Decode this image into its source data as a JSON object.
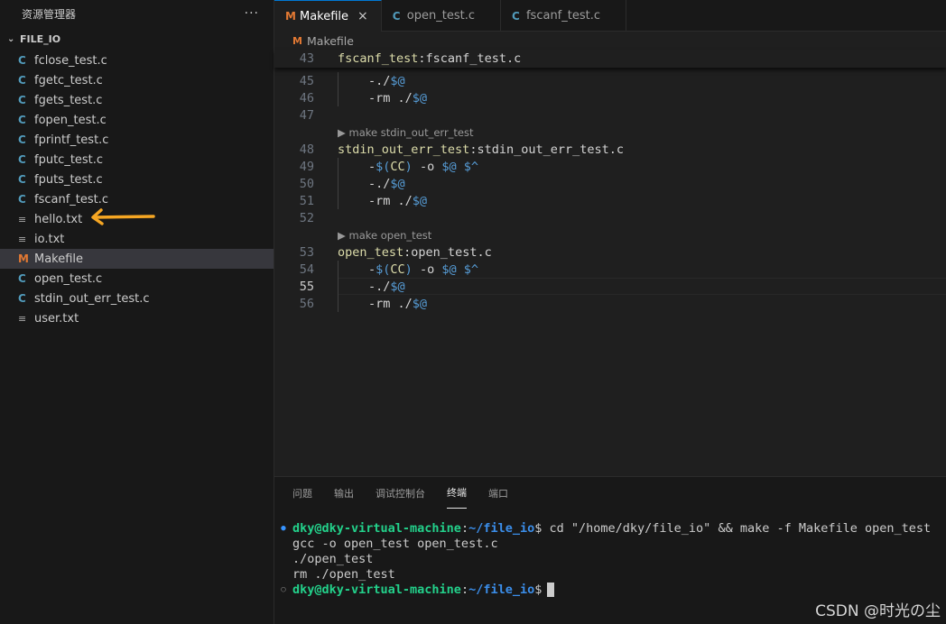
{
  "sidebar": {
    "title": "资源管理器",
    "more": "···",
    "folder": "FILE_IO",
    "files": [
      {
        "name": "fclose_test.c",
        "icon": "C"
      },
      {
        "name": "fgetc_test.c",
        "icon": "C"
      },
      {
        "name": "fgets_test.c",
        "icon": "C"
      },
      {
        "name": "fopen_test.c",
        "icon": "C"
      },
      {
        "name": "fprintf_test.c",
        "icon": "C"
      },
      {
        "name": "fputc_test.c",
        "icon": "C"
      },
      {
        "name": "fputs_test.c",
        "icon": "C"
      },
      {
        "name": "fscanf_test.c",
        "icon": "C"
      },
      {
        "name": "hello.txt",
        "icon": "≡"
      },
      {
        "name": "io.txt",
        "icon": "≡"
      },
      {
        "name": "Makefile",
        "icon": "M"
      },
      {
        "name": "open_test.c",
        "icon": "C"
      },
      {
        "name": "stdin_out_err_test.c",
        "icon": "C"
      },
      {
        "name": "user.txt",
        "icon": "≡"
      }
    ],
    "selected": "Makefile"
  },
  "annotation": {
    "arrow_color": "#f5a623",
    "points_to": "hello.txt"
  },
  "tabs": [
    {
      "label": "Makefile",
      "icon": "M",
      "close": "×"
    },
    {
      "label": "open_test.c",
      "icon": "C"
    },
    {
      "label": "fscanf_test.c",
      "icon": "C"
    }
  ],
  "breadcrumb": {
    "icon": "M",
    "label": "Makefile"
  },
  "editor": {
    "sticky": {
      "ln": "43",
      "target": "fscanf_test",
      "dep": "fscanf_test.c"
    },
    "lines": [
      {
        "ln": "45",
        "text": "-./$@"
      },
      {
        "ln": "46",
        "text": "-rm ./$@"
      },
      {
        "ln": "47",
        "text": ""
      },
      {
        "codelens": "▶ make stdin_out_err_test"
      },
      {
        "ln": "48",
        "target": "stdin_out_err_test",
        "dep": "stdin_out_err_test.c"
      },
      {
        "ln": "49",
        "text": "-$(CC) -o $@ $^"
      },
      {
        "ln": "50",
        "text": "-./$@"
      },
      {
        "ln": "51",
        "text": "-rm ./$@"
      },
      {
        "ln": "52",
        "text": ""
      },
      {
        "codelens": "▶ make open_test"
      },
      {
        "ln": "53",
        "target": "open_test",
        "dep": "open_test.c"
      },
      {
        "ln": "54",
        "text": "-$(CC) -o $@ $^"
      },
      {
        "ln": "55",
        "text": "-./$@"
      },
      {
        "ln": "56",
        "text": "-rm ./$@"
      }
    ],
    "current_line": "55"
  },
  "panel": {
    "tabs": [
      "问题",
      "输出",
      "调试控制台",
      "终端",
      "端口"
    ],
    "active_tab": "终端",
    "terminal": {
      "user": "dky@dky-virtual-machine",
      "colon": ":",
      "path": "~/file_io",
      "prompt_symbol": "$",
      "command": " cd \"/home/dky/file_io\" && make -f Makefile open_test",
      "output": [
        "gcc -o open_test open_test.c",
        "./open_test",
        "rm ./open_test"
      ]
    }
  },
  "watermark": "CSDN @时光の尘"
}
